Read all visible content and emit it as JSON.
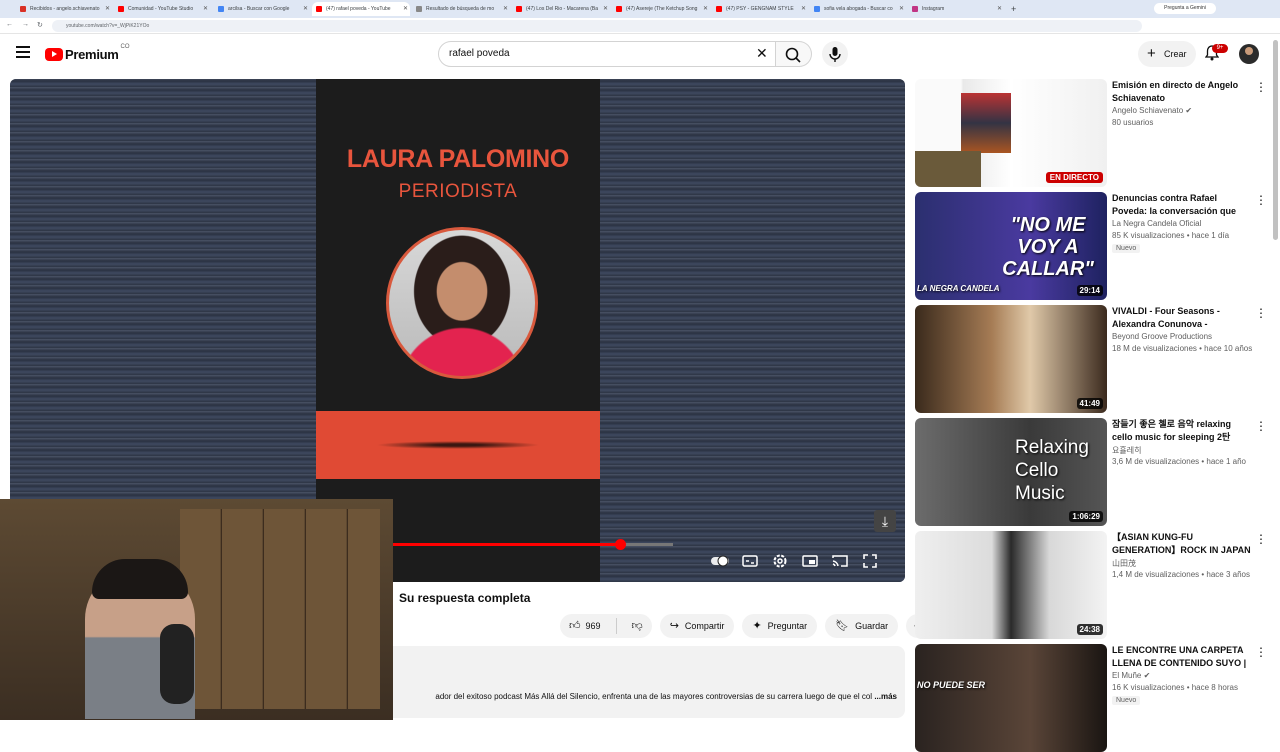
{
  "browser": {
    "tabs": [
      {
        "title": "Recibidos - angelo.schiavenato",
        "active": false
      },
      {
        "title": "Comunidad - YouTube Studio",
        "active": false
      },
      {
        "title": "arcilsa - Buscar con Google",
        "active": false
      },
      {
        "title": "(47) rafael poveda - YouTube",
        "active": true
      },
      {
        "title": "Resultado de búsqueda de mo",
        "active": false
      },
      {
        "title": "(47) Los Del Rio - Macarena (Ba",
        "active": false
      },
      {
        "title": "(47) Asereje (The Ketchup Song",
        "active": false
      },
      {
        "title": "(47) PSY - GENGNAM STYLE",
        "active": false
      },
      {
        "title": "sofia vela abogada - Buscar co",
        "active": false
      },
      {
        "title": "Instagram",
        "active": false
      }
    ],
    "new_tab": "+",
    "gemini_label": "Pregunta a Gemini",
    "url": "youtube.com/watch?v=_WjPiK21YOo"
  },
  "header": {
    "logo_word": "Premium",
    "logo_country": "CO",
    "search_value": "rafael poveda",
    "create_label": "Crear",
    "notif_badge": "9+"
  },
  "player": {
    "card_title": "LAURA PALOMINO",
    "card_subtitle": "PERIODISTA",
    "progress": 0.81
  },
  "video": {
    "title": "Su respuesta completa",
    "likes": "969",
    "share_label": "Compartir",
    "ask_label": "Preguntar",
    "save_label": "Guardar",
    "description": "ador del exitoso podcast Más Allá del Silencio, enfrenta una de las mayores controversias de su carrera luego de que el col",
    "more_label": "...más"
  },
  "recommendations": [
    {
      "title": "Emisión en directo de Angelo Schiavenato",
      "channel": "Angelo Schiavenato",
      "verified": true,
      "meta": "80 usuarios",
      "badge": "EN DIRECTO",
      "duration": "",
      "isnew": false
    },
    {
      "title": "Denuncias contra Rafael Poveda: la conversación que encendió el ...",
      "channel": "La Negra Candela Oficial",
      "verified": false,
      "meta": "85 K visualizaciones • hace 1 día",
      "badge": "",
      "duration": "29:14",
      "isnew": true,
      "thumb_text": "\"NO ME VOY A CALLAR\"",
      "thumb_sub": "LA NEGRA CANDELA"
    },
    {
      "title": "VIVALDI - Four Seasons - Alexandra Conunova - Orchestre ...",
      "channel": "Beyond Groove Productions",
      "verified": false,
      "meta": "18 M de visualizaciones • hace 10 años",
      "badge": "",
      "duration": "41:49",
      "isnew": false
    },
    {
      "title": "잠들기 좋은 첼로 음악 relaxing cello music for sleeping 2탄",
      "channel": "요휼레히",
      "verified": false,
      "meta": "3,6 M de visualizaciones • hace 1 año",
      "badge": "",
      "duration": "1:06:29",
      "isnew": false,
      "thumb_text": "Relaxing Cello Music"
    },
    {
      "title": "【ASIAN KUNG-FU GENERATION】ROCK IN JAPAN ...",
      "channel": "山田茂",
      "verified": false,
      "meta": "1,4 M de visualizaciones • hace 3 años",
      "badge": "",
      "duration": "24:38",
      "isnew": false
    },
    {
      "title": "LE ENCONTRE UNA CARPETA LLENA DE CONTENIDO SUYO | ...",
      "channel": "El Muñe",
      "verified": true,
      "meta": "16 K visualizaciones • hace 8 horas",
      "badge": "",
      "duration": "",
      "isnew": true,
      "thumb_text": "NO PUEDE SER"
    }
  ],
  "new_label": "Nuevo",
  "colors": {
    "brand_red": "#ff0000",
    "live_red": "#cc0000",
    "card_orange": "#e8553d"
  }
}
